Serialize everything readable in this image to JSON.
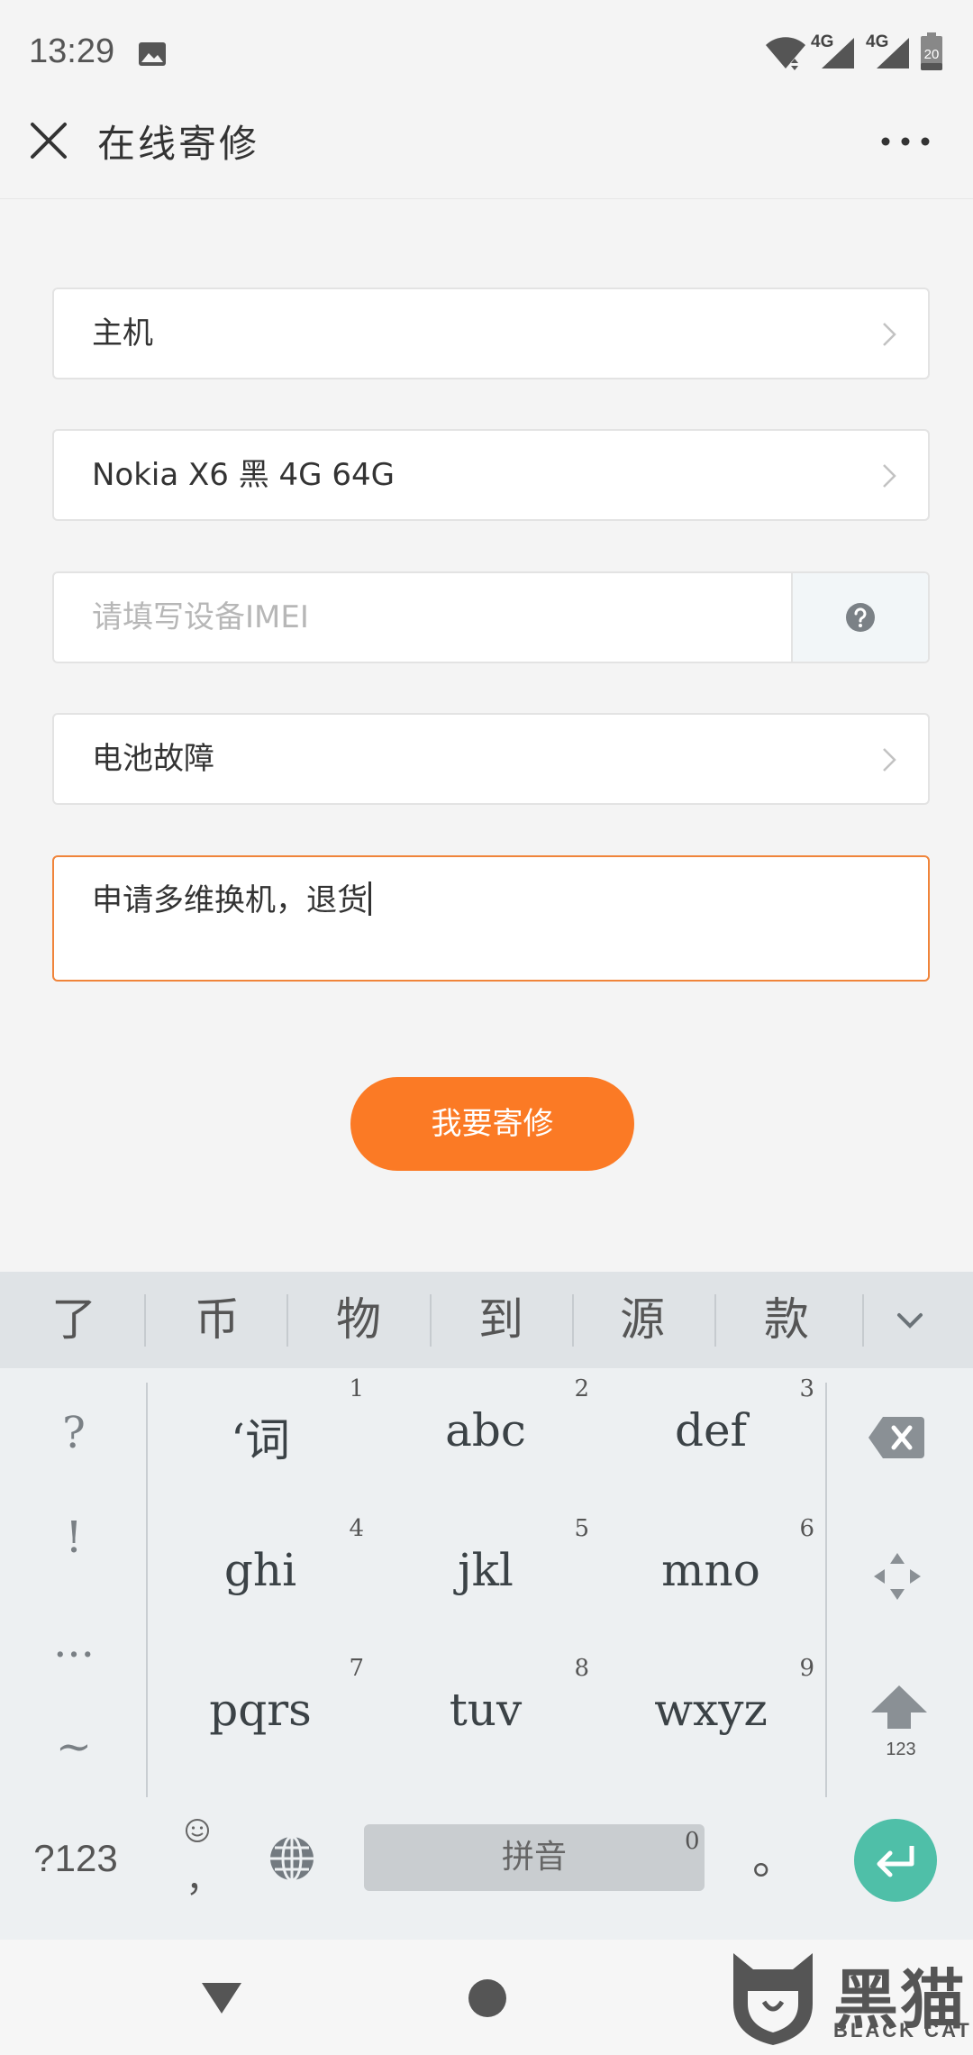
{
  "status_bar": {
    "time": "13:29",
    "network_1": "4G",
    "network_2": "4G",
    "battery": "20"
  },
  "header": {
    "title": "在线寄修"
  },
  "form": {
    "device_type": "主机",
    "model": "Nokia X6 黑 4G 64G",
    "imei_placeholder": "请填写设备IMEI",
    "fault": "电池故障",
    "description": "申请多维换机，退货"
  },
  "submit_label": "我要寄修",
  "keyboard": {
    "candidates": [
      "了",
      "币",
      "物",
      "到",
      "源",
      "款"
    ],
    "symbols": [
      "?",
      "!",
      "...",
      "~"
    ],
    "keys": [
      {
        "label": "‘词",
        "number": "1"
      },
      {
        "label": "abc",
        "number": "2"
      },
      {
        "label": "def",
        "number": "3"
      },
      {
        "label": "ghi",
        "number": "4"
      },
      {
        "label": "jkl",
        "number": "5"
      },
      {
        "label": "mno",
        "number": "6"
      },
      {
        "label": "pqrs",
        "number": "7"
      },
      {
        "label": "tuv",
        "number": "8"
      },
      {
        "label": "wxyz",
        "number": "9"
      }
    ],
    "shift_label": "123",
    "numeric_label": "?123",
    "comma": "，",
    "space_label": "拼音",
    "space_number": "0",
    "period": "。",
    "accent_color": "#4fbfa8"
  },
  "watermark": {
    "main": "黑猫",
    "sub": "BLACK CAT"
  },
  "colors": {
    "accent": "#fb7a25",
    "focus_border": "#f0843a",
    "enter_key": "#4fbfa8"
  }
}
